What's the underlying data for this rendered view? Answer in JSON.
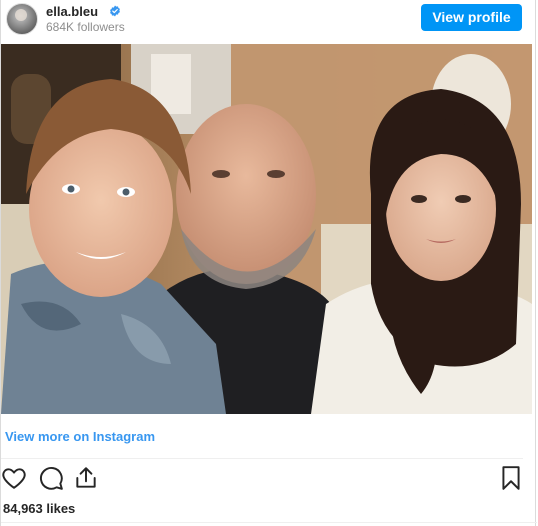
{
  "header": {
    "username": "ella.bleu",
    "followers": "684K followers",
    "view_profile_label": "View profile",
    "verified_icon": "verified-badge-icon",
    "avatar_icon": "avatar"
  },
  "post": {
    "image_alt": "Selfie of three people sitting in a private jet cabin"
  },
  "footer": {
    "view_more_label": "View more on Instagram",
    "likes": "84,963 likes",
    "icons": [
      "heart-icon",
      "comment-icon",
      "share-icon",
      "bookmark-icon"
    ]
  },
  "colors": {
    "accent": "#0095f6",
    "link": "#3897f0",
    "text": "#262626",
    "muted": "#8e8e8e"
  }
}
